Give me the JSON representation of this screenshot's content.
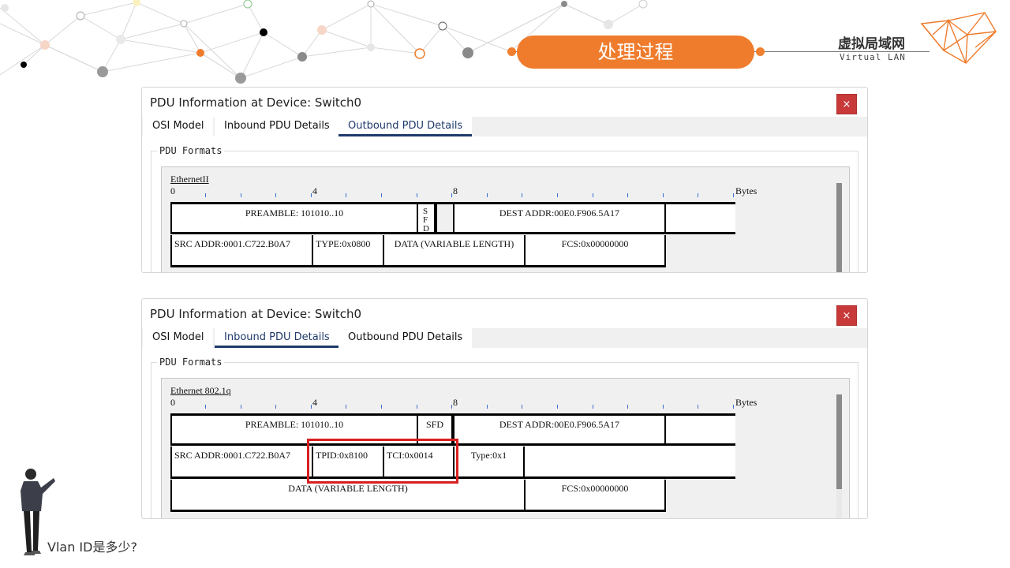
{
  "slide": {
    "title": "处理过程",
    "brand_title": "虚拟局域网",
    "brand_sub": "Virtual LAN",
    "question": "Vlan ID是多少?",
    "accent_color": "#ef7c2c",
    "highlight_color": "#d82020"
  },
  "windows": [
    {
      "title": "PDU Information at Device: Switch0",
      "close_label": "×",
      "tabs": [
        "OSI Model",
        "Inbound PDU Details",
        "Outbound PDU Details"
      ],
      "active_tab": "Outbound PDU Details",
      "group_label": "PDU Formats",
      "format_name": "EthernetII",
      "ruler": [
        "0",
        "4",
        "8"
      ],
      "bytes_label": "Bytes",
      "fields": {
        "preamble": "PREAMBLE:  101010..10",
        "sfd_lines": [
          "S",
          "F",
          "D"
        ],
        "dest": "DEST ADDR:00E0.F906.5A17",
        "src": "SRC ADDR:0001.C722.B0A7",
        "type": "TYPE:0x0800",
        "data": "DATA (VARIABLE LENGTH)",
        "fcs": "FCS:0x00000000"
      }
    },
    {
      "title": "PDU Information at Device: Switch0",
      "close_label": "×",
      "tabs": [
        "OSI Model",
        "Inbound PDU Details",
        "Outbound PDU Details"
      ],
      "active_tab": "Inbound PDU Details",
      "group_label": "PDU Formats",
      "format_name": "Ethernet 802.1q",
      "ruler": [
        "0",
        "4",
        "8"
      ],
      "bytes_label": "Bytes",
      "fields": {
        "preamble": "PREAMBLE:  101010..10",
        "sfd": "SFD",
        "dest": "DEST ADDR:00E0.F906.5A17",
        "src": "SRC ADDR:0001.C722.B0A7",
        "tpid": "TPID:0x8100",
        "tci": "TCI:0x0014",
        "type": "Type:0x1",
        "data": "DATA (VARIABLE LENGTH)",
        "fcs": "FCS:0x00000000"
      }
    }
  ]
}
